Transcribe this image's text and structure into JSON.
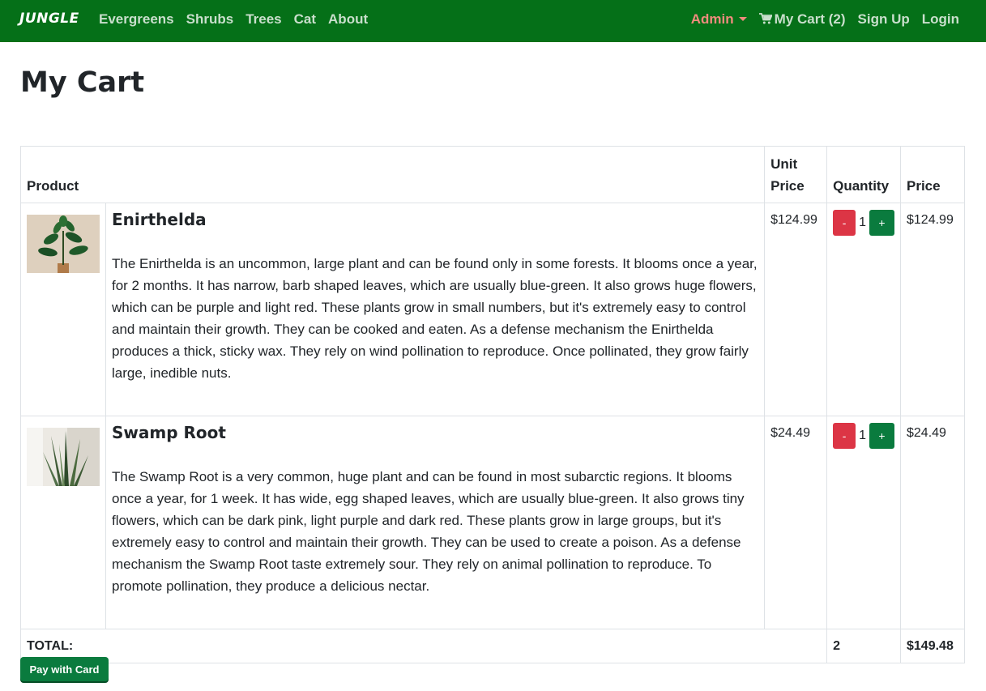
{
  "navbar": {
    "brand": "JUNGLE",
    "links": [
      "Evergreens",
      "Shrubs",
      "Trees",
      "Cat",
      "About"
    ],
    "admin": "Admin",
    "cart": "My Cart (2)",
    "signup": "Sign Up",
    "login": "Login",
    "colors": {
      "background": "#057018",
      "link": "#c9dfcc",
      "admin": "#f08c7e"
    }
  },
  "page": {
    "title": "My Cart"
  },
  "table": {
    "headers": {
      "product": "Product",
      "unit_price": "Unit Price",
      "quantity": "Quantity",
      "price": "Price"
    },
    "items": [
      {
        "name": "Enirthelda",
        "description": "The Enirthelda is an uncommon, large plant and can be found only in some forests. It blooms once a year, for 2 months. It has narrow, barb shaped leaves, which are usually blue-green. It also grows huge flowers, which can be purple and light red. These plants grow in small numbers, but it's extremely easy to control and maintain their growth. They can be cooked and eaten. As a defense mechanism the Enirthelda produces a thick, sticky wax. They rely on wind pollination to reproduce. Once pollinated, they grow fairly large, inedible nuts.",
        "unit_price": "$124.99",
        "quantity": "1",
        "price": "$124.99",
        "minus_label": "-",
        "plus_label": "+",
        "image_icon": "plant-photo"
      },
      {
        "name": "Swamp Root",
        "description": "The Swamp Root is a very common, huge plant and can be found in most subarctic regions. It blooms once a year, for 1 week. It has wide, egg shaped leaves, which are usually blue-green. It also grows tiny flowers, which can be dark pink, light purple and dark red. These plants grow in large groups, but it's extremely easy to control and maintain their growth. They can be used to create a poison. As a defense mechanism the Swamp Root taste extremely sour. They rely on animal pollination to reproduce. To promote pollination, they produce a delicious nectar.",
        "unit_price": "$24.49",
        "quantity": "1",
        "price": "$24.49",
        "minus_label": "-",
        "plus_label": "+",
        "image_icon": "snake-plant-photo"
      }
    ],
    "total": {
      "label": "TOTAL:",
      "quantity": "2",
      "price": "$149.48"
    }
  },
  "actions": {
    "pay_label": "Pay with Card",
    "pay_color": "#0a7b3e"
  }
}
